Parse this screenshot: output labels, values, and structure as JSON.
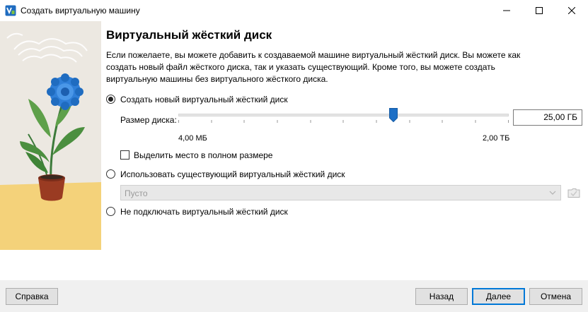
{
  "window": {
    "title": "Создать виртуальную машину",
    "controls": [
      "minimize-icon",
      "maximize-icon",
      "close-icon"
    ]
  },
  "page": {
    "title": "Виртуальный жёсткий диск",
    "description": "Если пожелаете, вы можете добавить к создаваемой машине виртуальный жёсткий диск. Вы можете как создать новый файл жёсткого диска, так и указать существующий. Кроме того, вы можете создать виртуальную машины без виртуального жёсткого диска."
  },
  "options": {
    "create_new": {
      "label": "Создать новый виртуальный жёсткий диск",
      "checked": true
    },
    "use_existing": {
      "label": "Использовать существующий виртуальный жёсткий диск",
      "checked": false
    },
    "no_disk": {
      "label": "Не подключать виртуальный жёсткий диск",
      "checked": false
    }
  },
  "disk_size": {
    "label": "Размер диска:",
    "value": "25,00 ГБ",
    "min_label": "4,00 МБ",
    "max_label": "2,00 ТБ",
    "slider_fraction": 0.65
  },
  "preallocate": {
    "label": "Выделить место в полном размере",
    "checked": false
  },
  "existing_disk": {
    "selected": "Пусто"
  },
  "buttons": {
    "help": "Справка",
    "back": "Назад",
    "next": "Далее",
    "cancel": "Отмена"
  },
  "colors": {
    "accent": "#0078d7",
    "slider_handle": "#1c6fc6",
    "illustration_bg": "#ece8e1",
    "sun_yellow": "#f4d27a"
  }
}
